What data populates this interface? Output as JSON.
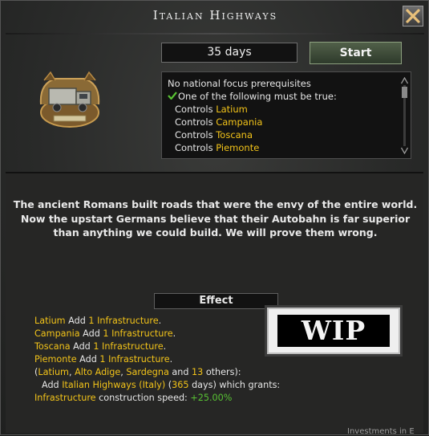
{
  "title": "Italian Highways",
  "duration": "35 days",
  "start_label": "Start",
  "prerequisites": {
    "no_focus": "No national focus prerequisites",
    "one_of": "One of the following must be true:",
    "controls_label": "Controls",
    "regions": [
      "Latium",
      "Campania",
      "Toscana",
      "Piemonte"
    ]
  },
  "description": [
    "The ancient Romans built roads that were the envy of the entire world.",
    "Now the upstart Germans believe that their Autobahn is far superior",
    "than anything we could build. We will prove them wrong."
  ],
  "effect_header": "Effect",
  "effects": {
    "add_label": "Add",
    "amount": "1",
    "building": "Infrastructure",
    "lines": [
      {
        "region": "Latium"
      },
      {
        "region": "Campania"
      },
      {
        "region": "Toscana"
      },
      {
        "region": "Piemonte"
      }
    ],
    "group": {
      "open": "(",
      "r1": "Latium",
      "r2": "Alto Adige",
      "r3": "Sardegna",
      "and": "and",
      "count": "13",
      "others": "others):"
    },
    "modifier": {
      "add": "Add",
      "name": "Italian Highways (Italy)",
      "days": "365",
      "days_suffix": "days) which grants:"
    },
    "bonus": {
      "stat": "Infrastructure",
      "label": "construction speed:",
      "value": "+25.00%"
    }
  },
  "wip_label": "WIP",
  "footer_text": "Investments in E",
  "icons": {
    "close": "close-x-icon",
    "check": "checkmark-icon",
    "focus": "truck-focus-icon"
  },
  "colors": {
    "highlight": "#f2c319",
    "positive": "#58c233"
  }
}
